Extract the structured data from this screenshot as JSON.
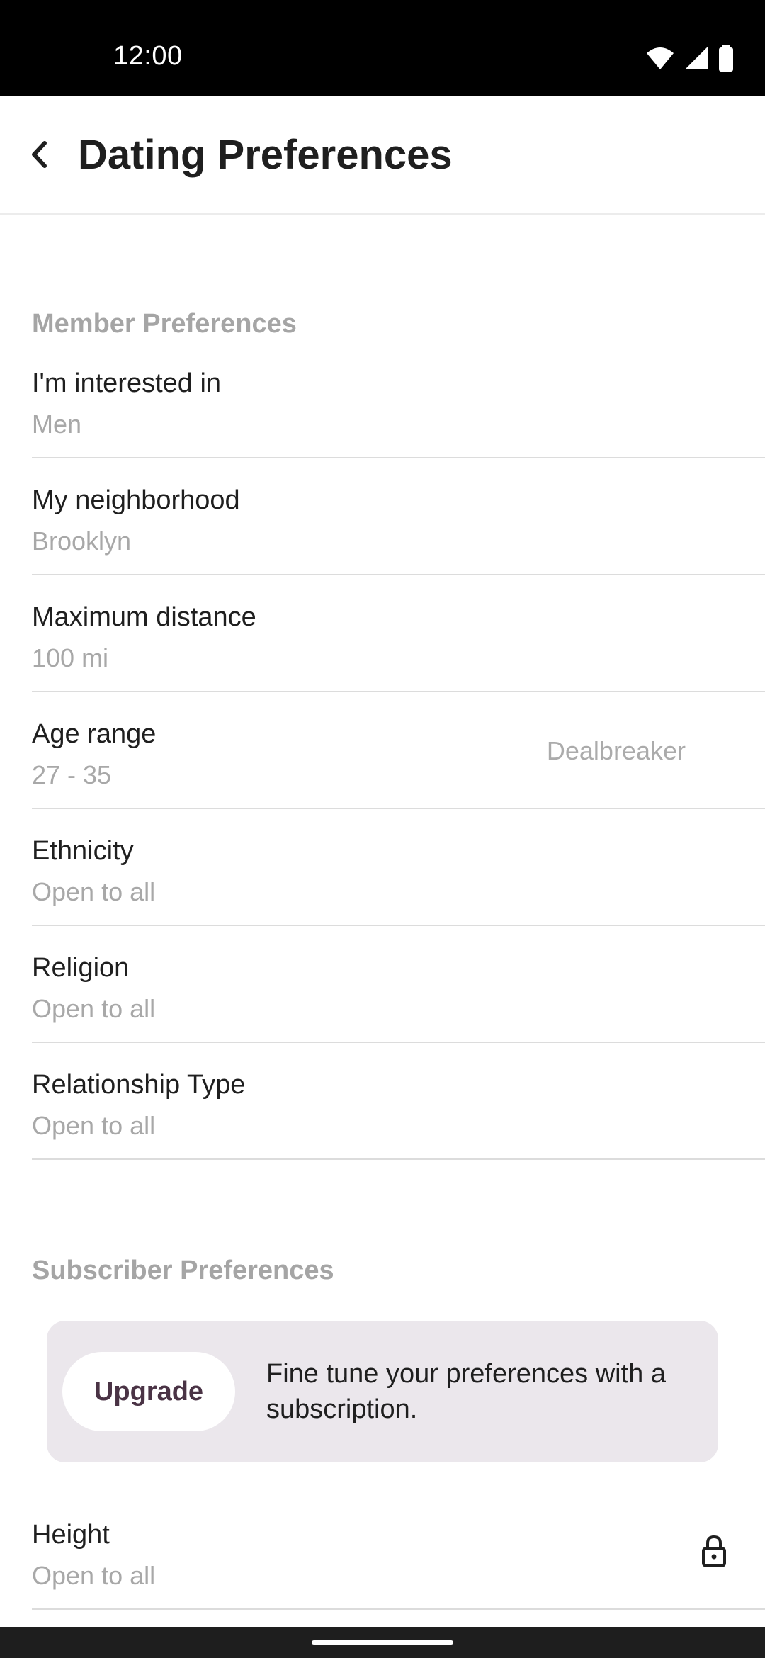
{
  "status_bar": {
    "time": "12:00"
  },
  "header": {
    "title": "Dating Preferences"
  },
  "member_section": {
    "title": "Member Preferences",
    "items": [
      {
        "label": "I'm interested in",
        "value": "Men"
      },
      {
        "label": "My neighborhood",
        "value": "Brooklyn"
      },
      {
        "label": "Maximum distance",
        "value": "100 mi"
      },
      {
        "label": "Age range",
        "value": "27 - 35",
        "tag": "Dealbreaker"
      },
      {
        "label": "Ethnicity",
        "value": "Open to all"
      },
      {
        "label": "Religion",
        "value": "Open to all"
      },
      {
        "label": "Relationship Type",
        "value": "Open to all"
      }
    ]
  },
  "subscriber_section": {
    "title": "Subscriber Preferences",
    "upgrade_card": {
      "button_label": "Upgrade",
      "text": "Fine tune your preferences with a subscription."
    },
    "items": [
      {
        "label": "Height",
        "value": "Open to all",
        "icon": "lock-icon"
      }
    ]
  },
  "colors": {
    "section_header": "#a5a5a5",
    "value_text": "#a8a8a8",
    "upgrade_card_bg": "#ebe7ec",
    "upgrade_button_text": "#4a3345"
  }
}
